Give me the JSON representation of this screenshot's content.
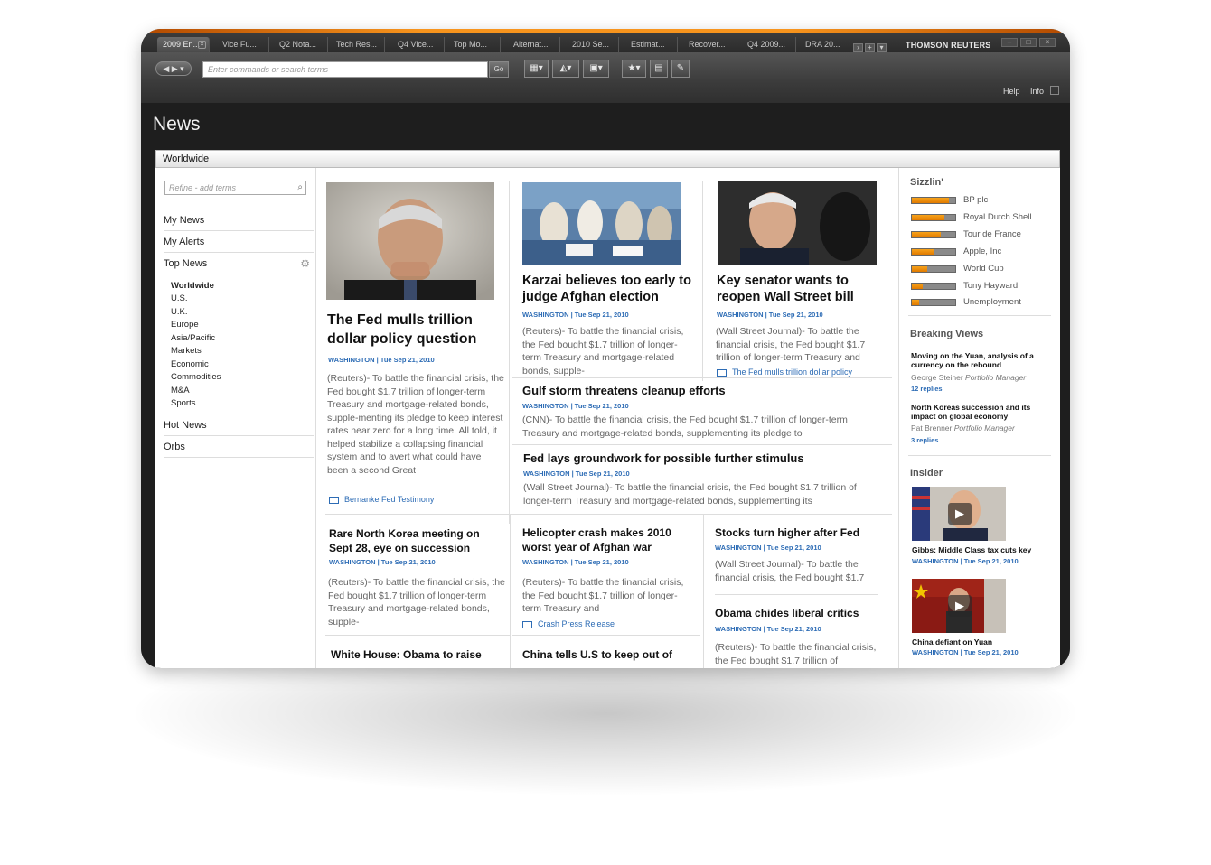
{
  "app": {
    "brand": "THOMSON REUTERS",
    "tabs": [
      "2009 En...",
      "Vice Fu...",
      "Q2 Nota...",
      "Tech Res...",
      "Q4 Vice...",
      "Top Mo...",
      "Alternat...",
      "2010 Se...",
      "Estimat...",
      "Recover...",
      "Q4 2009...",
      "DRA 20..."
    ],
    "search_placeholder": "Enter commands or search terms",
    "go_label": "Go",
    "help_label": "Help",
    "info_label": "Info",
    "page_title": "News"
  },
  "section_bar": "Worldwide",
  "sidebar": {
    "refine_placeholder": "Refine - add terms",
    "items": [
      "My News",
      "My Alerts",
      "Top News",
      "Hot News",
      "Orbs"
    ],
    "subitems": [
      "Worldwide",
      "U.S.",
      "U.K.",
      "Europe",
      "Asia/Pacific",
      "Markets",
      "Economic",
      "Commodities",
      "M&A",
      "Sports"
    ]
  },
  "articles": {
    "fed": {
      "headline": "The Fed mulls trillion dollar policy question",
      "dateline": "WASHINGTON | Tue Sep 21, 2010",
      "snippet": "(Reuters)- To battle the financial crisis, the Fed bought $1.7 trillion of longer-term Treasury and mortgage-related bonds, supple-menting its pledge to keep interest rates near zero for a long time. All told, it helped stabilize a collapsing financial system and to avert what could have been a second Great",
      "related": "Bernanke Fed Testimony"
    },
    "karzai": {
      "headline": "Karzai believes too early to judge Afghan election",
      "dateline": "WASHINGTON | Tue Sep 21, 2010",
      "snippet": "(Reuters)- To battle the financial crisis, the Fed bought $1.7 trillion of longer-term Treasury and mortgage-related bonds, supple-"
    },
    "senator": {
      "headline": "Key senator wants to reopen Wall Street bill",
      "dateline": "WASHINGTON | Tue Sep 21, 2010",
      "snippet": "(Wall Street Journal)- To battle the financial crisis, the Fed bought $1.7 trillion of longer-term Treasury and",
      "related": "The Fed mulls trillion dollar policy"
    },
    "gulf": {
      "headline": "Gulf storm threatens cleanup efforts",
      "dateline": "WASHINGTON | Tue Sep 21, 2010",
      "snippet": "(CNN)- To battle the financial crisis, the Fed bought $1.7 trillion of longer-term Treasury and mortgage-related bonds, supplementing its pledge to"
    },
    "stimulus": {
      "headline": "Fed lays groundwork for possible further stimulus",
      "dateline": "WASHINGTON | Tue Sep 21, 2010",
      "snippet": "(Wall Street Journal)- To battle the financial crisis, the Fed bought $1.7 trillion of longer-term Treasury and mortgage-related bonds, supplementing its"
    },
    "korea": {
      "headline": "Rare North Korea meeting on Sept 28, eye on succession",
      "dateline": "WASHINGTON | Tue Sep 21, 2010",
      "snippet": "(Reuters)- To battle the financial crisis, the Fed bought $1.7 trillion of longer-term Treasury and mortgage-related bonds, supple-"
    },
    "helicopter": {
      "headline": "Helicopter crash makes 2010 worst year of Afghan war",
      "dateline": "WASHINGTON | Tue Sep 21, 2010",
      "snippet": "(Reuters)- To battle the financial crisis, the Fed bought $1.7 trillion of longer-term Treasury and",
      "related": "Crash Press Release"
    },
    "stocks": {
      "headline": "Stocks turn higher after Fed",
      "dateline": "WASHINGTON | Tue Sep 21, 2010",
      "snippet": "(Wall Street Journal)- To battle the financial crisis, the Fed bought $1.7"
    },
    "obama_chides": {
      "headline": "Obama chides liberal critics",
      "dateline": "WASHINGTON | Tue Sep 21, 2010",
      "snippet": "(Reuters)- To battle the financial crisis, the Fed bought $1.7 trillion of"
    },
    "whitehouse": {
      "headline": "White House: Obama to raise"
    },
    "china": {
      "headline": "China tells U.S to keep out of"
    }
  },
  "sizzlin": {
    "title": "Sizzlin'",
    "items": [
      {
        "label": "BP plc",
        "level": 0.86
      },
      {
        "label": "Royal Dutch Shell",
        "level": 0.76
      },
      {
        "label": "Tour de France",
        "level": 0.66
      },
      {
        "label": "Apple, Inc",
        "level": 0.5
      },
      {
        "label": "World Cup",
        "level": 0.36
      },
      {
        "label": "Tony Hayward",
        "level": 0.24
      },
      {
        "label": "Unemployment",
        "level": 0.16
      }
    ]
  },
  "breaking_views": {
    "title": "Breaking Views",
    "items": [
      {
        "title": "Moving on the Yuan, analysis of a currency on the rebound",
        "author": "George Steiner",
        "role": "Portfolio Manager",
        "replies": "12 replies"
      },
      {
        "title": "North Koreas succession and its impact on global economy",
        "author": "Pat Brenner",
        "role": "Portfolio Manager",
        "replies": "3 replies"
      }
    ]
  },
  "insider": {
    "title": "Insider",
    "items": [
      {
        "title": "Gibbs: Middle Class tax cuts key",
        "dateline": "WASHINGTON | Tue Sep 21, 2010"
      },
      {
        "title": "China defiant on Yuan",
        "dateline": "WASHINGTON | Tue Sep 21, 2010"
      }
    ]
  },
  "colors": {
    "accent_orange": "#f7941d",
    "link_blue": "#2d6cb5"
  }
}
